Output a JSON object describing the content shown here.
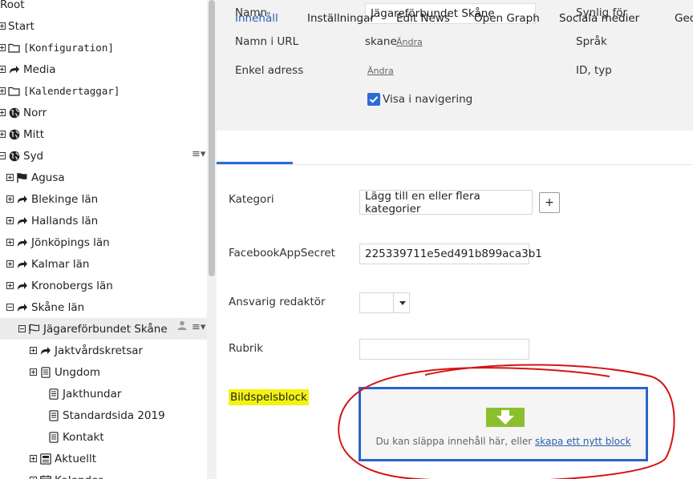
{
  "tree": {
    "items": [
      {
        "label": "Root",
        "icon": "none",
        "toggle": "none"
      },
      {
        "label": "Start",
        "icon": "none",
        "toggle": "plus"
      },
      {
        "label": "[Konfiguration]",
        "icon": "folder-icon",
        "toggle": "plus",
        "mono": true
      },
      {
        "label": "Media",
        "icon": "redirect-arrow-icon",
        "toggle": "plus"
      },
      {
        "label": "[Kalendertaggar]",
        "icon": "folder-icon",
        "toggle": "plus",
        "mono": true
      },
      {
        "label": "Norr",
        "icon": "globe-icon",
        "toggle": "plus"
      },
      {
        "label": "Mitt",
        "icon": "globe-icon",
        "toggle": "plus"
      },
      {
        "label": "Syd",
        "icon": "globe-icon",
        "toggle": "minus"
      },
      {
        "label": "Agusa",
        "icon": "flag-icon",
        "toggle": "plus"
      },
      {
        "label": "Blekinge län",
        "icon": "redirect-arrow-icon",
        "toggle": "plus"
      },
      {
        "label": "Hallands län",
        "icon": "redirect-arrow-icon",
        "toggle": "plus"
      },
      {
        "label": "Jönköpings län",
        "icon": "redirect-arrow-icon",
        "toggle": "plus"
      },
      {
        "label": "Kalmar län",
        "icon": "redirect-arrow-icon",
        "toggle": "plus"
      },
      {
        "label": "Kronobergs län",
        "icon": "redirect-arrow-icon",
        "toggle": "plus"
      },
      {
        "label": "Skåne län",
        "icon": "redirect-arrow-icon",
        "toggle": "minus"
      },
      {
        "label": "Jägareförbundet Skåne",
        "icon": "flag-outline-icon",
        "toggle": "minus",
        "selected": true
      },
      {
        "label": "Jaktvårdskretsar",
        "icon": "redirect-arrow-icon",
        "toggle": "plus"
      },
      {
        "label": "Ungdom",
        "icon": "page-icon",
        "toggle": "plus"
      },
      {
        "label": "Jakthundar",
        "icon": "page-icon",
        "toggle": "none"
      },
      {
        "label": "Standardsida 2019",
        "icon": "page-icon",
        "toggle": "none"
      },
      {
        "label": "Kontakt",
        "icon": "page-icon",
        "toggle": "none"
      },
      {
        "label": "Aktuellt",
        "icon": "list-page-icon",
        "toggle": "plus"
      },
      {
        "label": "Kalender",
        "icon": "calendar-icon",
        "toggle": "plus"
      }
    ]
  },
  "header": {
    "name_label": "Namn",
    "name_value": "Jägareförbundet Skåne",
    "url_label": "Namn i URL",
    "url_value": "skane",
    "change_link": "Ändra",
    "simple_label": "Enkel adress",
    "simple_change_link": "Ändra",
    "visible_label": "Synlig för",
    "lang_label": "Språk",
    "id_label": "ID, typ",
    "nav_checkbox_label": "Visa i navigering",
    "nav_checked": true
  },
  "tabs": [
    "Innehåll",
    "Inställningar",
    "Edit News",
    "Open Graph",
    "Sociala medier",
    "Geo"
  ],
  "active_tab": "Innehåll",
  "form": {
    "category_label": "Kategori",
    "category_placeholder": "Lägg till en eller flera kategorier",
    "add_button": "+",
    "secret_label": "FacebookAppSecret",
    "secret_value": "225339711e5ed491b899aca3b1",
    "editor_label": "Ansvarig redaktör",
    "rubrik_label": "Rubrik",
    "rubrik_value": "",
    "bildspel_label": "Bildspelsblock",
    "drop_text": "Du kan släppa innehåll här, eller ",
    "drop_link": "skapa ett nytt block"
  },
  "colors": {
    "accent": "#2a6bd6",
    "highlight": "#f3f312",
    "drop_icon": "#8cbf2e",
    "annotation": "#d41414"
  }
}
